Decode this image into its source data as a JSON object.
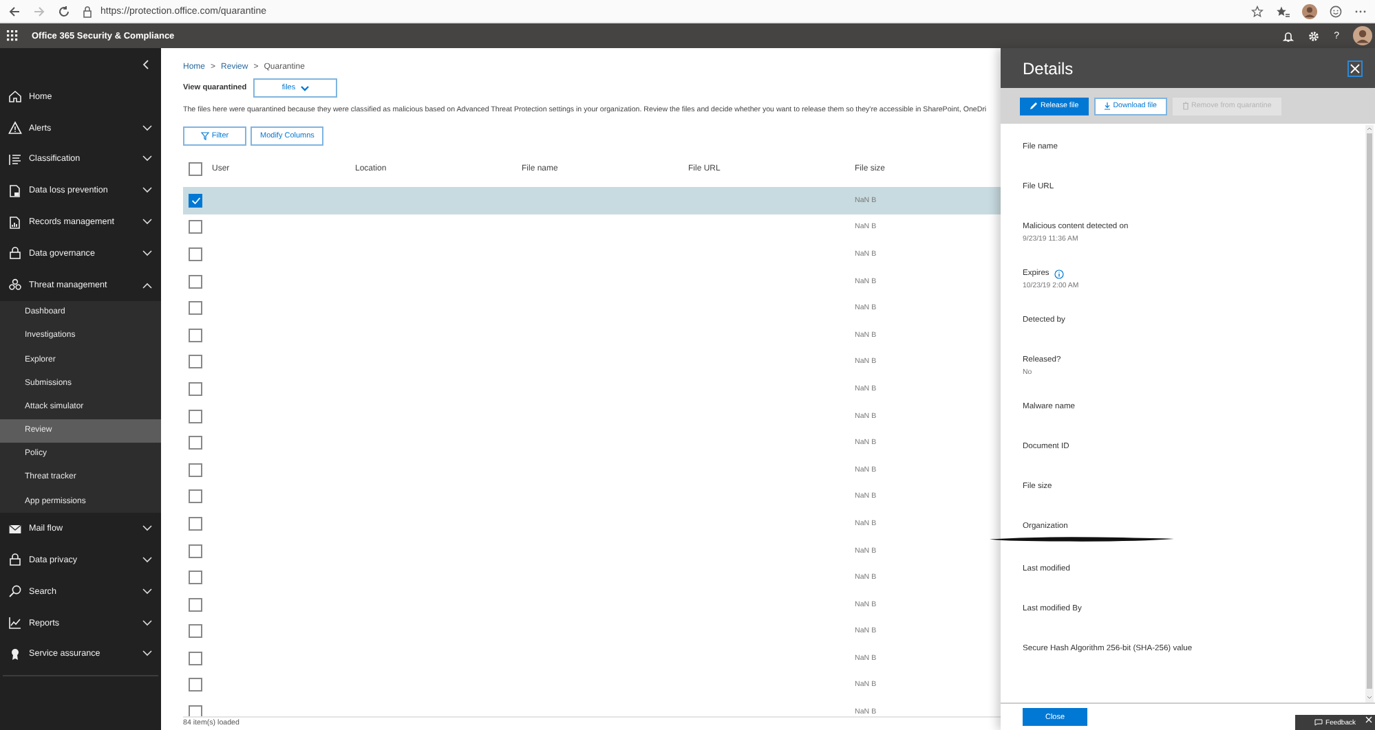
{
  "browser": {
    "url": "https://protection.office.com/quarantine"
  },
  "app_bar": {
    "title": "Office 365 Security & Compliance",
    "help": "?"
  },
  "sidebar": {
    "items": [
      {
        "label": "Home",
        "kind": "link"
      },
      {
        "label": "Alerts",
        "kind": "group",
        "expanded": false
      },
      {
        "label": "Classification",
        "kind": "group",
        "expanded": false
      },
      {
        "label": "Data loss prevention",
        "kind": "group",
        "expanded": false
      },
      {
        "label": "Records management",
        "kind": "group",
        "expanded": false
      },
      {
        "label": "Data governance",
        "kind": "group",
        "expanded": false
      },
      {
        "label": "Threat management",
        "kind": "group",
        "expanded": true,
        "children": [
          {
            "label": "Dashboard",
            "selected": false
          },
          {
            "label": "Investigations",
            "selected": false
          },
          {
            "label": "Explorer",
            "selected": false
          },
          {
            "label": "Submissions",
            "selected": false
          },
          {
            "label": "Attack simulator",
            "selected": false
          },
          {
            "label": "Review",
            "selected": true
          },
          {
            "label": "Policy",
            "selected": false
          },
          {
            "label": "Threat tracker",
            "selected": false
          },
          {
            "label": "App permissions",
            "selected": false
          }
        ]
      },
      {
        "label": "Mail flow",
        "kind": "group",
        "expanded": false
      },
      {
        "label": "Data privacy",
        "kind": "group",
        "expanded": false
      },
      {
        "label": "Search",
        "kind": "group",
        "expanded": false
      },
      {
        "label": "Reports",
        "kind": "group",
        "expanded": false
      },
      {
        "label": "Service assurance",
        "kind": "group",
        "expanded": false
      }
    ]
  },
  "breadcrumb": [
    {
      "kind": "link",
      "text": "Home"
    },
    {
      "kind": "separator",
      "text": ">"
    },
    {
      "kind": "link",
      "text": "Review"
    },
    {
      "kind": "separator",
      "text": ">"
    },
    {
      "kind": "current",
      "text": "Quarantine"
    }
  ],
  "view": {
    "label": "View quarantined",
    "value": "files"
  },
  "description": "The files here were quarantined because they were classified as malicious based on Advanced Threat Protection settings in your organization. Review the files and decide whether you want to release them so they're accessible in SharePoint, OneDri",
  "toolbar": [
    {
      "kind": "filter",
      "label": "Filter"
    },
    {
      "kind": "plain",
      "label": "Modify Columns"
    }
  ],
  "table": {
    "all_checked": false,
    "columns": [
      "User",
      "Location",
      "File name",
      "File URL",
      "File size"
    ],
    "rows": [
      {
        "selected": true,
        "file_size": "NaN B"
      },
      {
        "selected": false,
        "file_size": "NaN B"
      },
      {
        "selected": false,
        "file_size": "NaN B"
      },
      {
        "selected": false,
        "file_size": "NaN B"
      },
      {
        "selected": false,
        "file_size": "NaN B"
      },
      {
        "selected": false,
        "file_size": "NaN B"
      },
      {
        "selected": false,
        "file_size": "NaN B"
      },
      {
        "selected": false,
        "file_size": "NaN B"
      },
      {
        "selected": false,
        "file_size": "NaN B"
      },
      {
        "selected": false,
        "file_size": "NaN B"
      },
      {
        "selected": false,
        "file_size": "NaN B"
      },
      {
        "selected": false,
        "file_size": "NaN B"
      },
      {
        "selected": false,
        "file_size": "NaN B"
      },
      {
        "selected": false,
        "file_size": "NaN B"
      },
      {
        "selected": false,
        "file_size": "NaN B"
      },
      {
        "selected": false,
        "file_size": "NaN B"
      },
      {
        "selected": false,
        "file_size": "NaN B"
      },
      {
        "selected": false,
        "file_size": "NaN B"
      },
      {
        "selected": false,
        "file_size": "NaN B"
      },
      {
        "selected": false,
        "file_size": "NaN B"
      }
    ]
  },
  "status": "84 item(s) loaded",
  "details": {
    "title": "Details",
    "actions": [
      {
        "kind": "primary",
        "label": "Release file",
        "disabled": false
      },
      {
        "kind": "download",
        "label": "Download file",
        "disabled": false
      },
      {
        "kind": "delete",
        "label": "Remove from quarantine",
        "disabled": true
      }
    ],
    "fields": [
      {
        "label": "File name"
      },
      {
        "label": "File URL"
      },
      {
        "label": "Malicious content detected on",
        "value": "9/23/19 11:36 AM"
      },
      {
        "label": "Expires",
        "info": true,
        "value": "10/23/19 2:00 AM"
      },
      {
        "label": "Detected by"
      },
      {
        "label": "Released?",
        "value": "No"
      },
      {
        "label": "Malware name"
      },
      {
        "label": "Document ID"
      },
      {
        "label": "File size"
      },
      {
        "label": "Organization",
        "redacted": true
      },
      {
        "label": "Last modified"
      },
      {
        "label": "Last modified By"
      },
      {
        "label": "Secure Hash Algorithm 256-bit (SHA-256) value"
      }
    ],
    "close": "Close"
  },
  "feedback": {
    "label": "Feedback"
  }
}
